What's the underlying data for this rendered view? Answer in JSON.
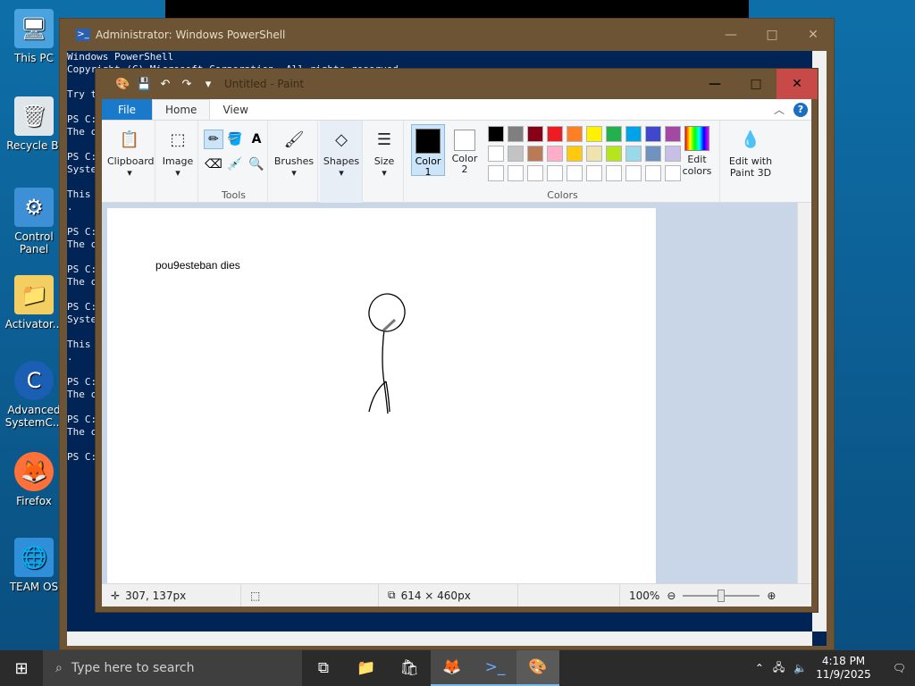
{
  "desktop": {
    "icons": [
      {
        "label": "This PC",
        "icon": "computer-icon"
      },
      {
        "label": "Recycle Bi",
        "icon": "recycle-bin-icon"
      },
      {
        "label": "Control Panel",
        "icon": "control-panel-icon"
      },
      {
        "label": "Activator...",
        "icon": "folder-icon"
      },
      {
        "label": "Advanced SystemC...",
        "icon": "advanced-systemcare-icon"
      },
      {
        "label": "Firefox",
        "icon": "firefox-icon"
      },
      {
        "label": "TEAM OS",
        "icon": "globe-icon"
      }
    ]
  },
  "powershell": {
    "title": "Administrator: Windows PowerShell",
    "lines": [
      "Windows PowerShell",
      "Copyright (C) Microsoft Corporation. All rights reserved.",
      "",
      "Try t",
      "",
      "PS C:",
      "The c",
      "",
      "PS C:",
      "Syste",
      "",
      "This ",
      ".",
      "",
      "PS C:",
      "The c",
      "",
      "PS C:",
      "The c",
      "",
      "PS C:",
      "Syste",
      "",
      "This ",
      ".",
      "",
      "PS C:",
      "The c",
      "",
      "PS C:",
      "The c",
      "",
      "PS C:"
    ]
  },
  "paint": {
    "title": "Untitled - Paint",
    "tabs": {
      "file": "File",
      "home": "Home",
      "view": "View"
    },
    "ribbon": {
      "clipboard": "Clipboard",
      "image": "Image",
      "tools_group": "Tools",
      "brushes": "Brushes",
      "shapes": "Shapes",
      "size": "Size",
      "color1": "Color\n1",
      "color2": "Color\n2",
      "colors_group": "Colors",
      "edit_colors": "Edit\ncolors",
      "edit_3d": "Edit with\nPaint 3D"
    },
    "palette_row1": [
      "#000000",
      "#7f7f7f",
      "#880015",
      "#ed1c24",
      "#ff7f27",
      "#fff200",
      "#22b14c",
      "#00a2e8",
      "#3f48cc",
      "#a349a4"
    ],
    "palette_row2": [
      "#ffffff",
      "#c3c3c3",
      "#b97a57",
      "#ffaec9",
      "#ffc90e",
      "#efe4b0",
      "#b5e61d",
      "#99d9ea",
      "#7092be",
      "#c8bfe7"
    ],
    "canvas_text": "pou9esteban dies",
    "status": {
      "cursor": "307, 137px",
      "canvas_size": "614 × 460px",
      "zoom": "100%"
    }
  },
  "taskbar": {
    "search_placeholder": "Type here to search",
    "time": "4:18 PM",
    "date": "11/9/2025"
  }
}
